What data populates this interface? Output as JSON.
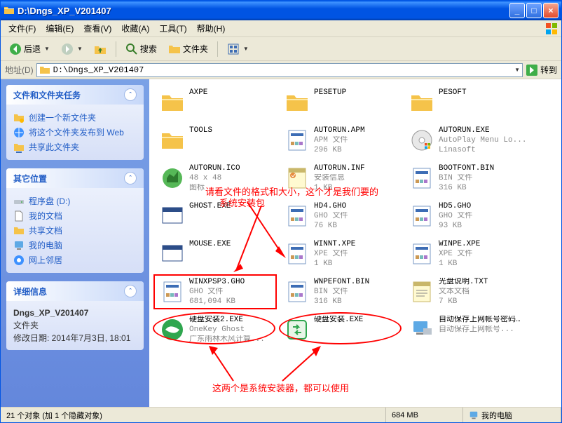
{
  "title": "D:\\Dngs_XP_V201407",
  "menu": [
    "文件(F)",
    "编辑(E)",
    "查看(V)",
    "收藏(A)",
    "工具(T)",
    "帮助(H)"
  ],
  "toolbar": {
    "back": "后退",
    "search": "搜索",
    "folders": "文件夹"
  },
  "address": {
    "label": "地址(D)",
    "value": "D:\\Dngs_XP_V201407",
    "go": "转到"
  },
  "sidebar": {
    "tasks": {
      "title": "文件和文件夹任务",
      "items": [
        "创建一个新文件夹",
        "将这个文件夹发布到 Web",
        "共享此文件夹"
      ]
    },
    "places": {
      "title": "其它位置",
      "items": [
        "程序盘 (D:)",
        "我的文档",
        "共享文档",
        "我的电脑",
        "网上邻居"
      ]
    },
    "details": {
      "title": "详细信息",
      "name": "Dngs_XP_V201407",
      "type": "文件夹",
      "modified": "修改日期: 2014年7月3日, 18:01"
    }
  },
  "files": [
    {
      "name": "AXPE",
      "meta1": "",
      "meta2": "",
      "icon": "folder"
    },
    {
      "name": "PESETUP",
      "meta1": "",
      "meta2": "",
      "icon": "folder"
    },
    {
      "name": "PESOFT",
      "meta1": "",
      "meta2": "",
      "icon": "folder"
    },
    {
      "name": "TOOLS",
      "meta1": "",
      "meta2": "",
      "icon": "folder"
    },
    {
      "name": "AUTORUN.APM",
      "meta1": "APM 文件",
      "meta2": "296 KB",
      "icon": "doc"
    },
    {
      "name": "AUTORUN.EXE",
      "meta1": "AutoPlay Menu Lo...",
      "meta2": "Linasoft",
      "icon": "disc"
    },
    {
      "name": "AUTORUN.ICO",
      "meta1": "48 x 48",
      "meta2": "图标",
      "icon": "ico"
    },
    {
      "name": "AUTORUN.INF",
      "meta1": "安装信息",
      "meta2": "1 KB",
      "icon": "inf"
    },
    {
      "name": "BOOTFONT.BIN",
      "meta1": "BIN 文件",
      "meta2": "316 KB",
      "icon": "doc"
    },
    {
      "name": "GHOST.EXE",
      "meta1": "",
      "meta2": "",
      "icon": "app"
    },
    {
      "name": "HD4.GHO",
      "meta1": "GHO 文件",
      "meta2": "76 KB",
      "icon": "doc"
    },
    {
      "name": "HD5.GHO",
      "meta1": "GHO 文件",
      "meta2": "93 KB",
      "icon": "doc"
    },
    {
      "name": "MOUSE.EXE",
      "meta1": "",
      "meta2": "",
      "icon": "app"
    },
    {
      "name": "WINNT.XPE",
      "meta1": "XPE 文件",
      "meta2": "1 KB",
      "icon": "doc"
    },
    {
      "name": "WINPE.XPE",
      "meta1": "XPE 文件",
      "meta2": "1 KB",
      "icon": "doc"
    },
    {
      "name": "WINXPSP3.GHO",
      "meta1": "GHO 文件",
      "meta2": "681,094 KB",
      "icon": "doc"
    },
    {
      "name": "WNPEFONT.BIN",
      "meta1": "BIN 文件",
      "meta2": "316 KB",
      "icon": "doc"
    },
    {
      "name": "光盘说明.TXT",
      "meta1": "文本文档",
      "meta2": "7 KB",
      "icon": "txt"
    },
    {
      "name": "硬盘安装2.EXE",
      "meta1": "OneKey Ghost",
      "meta2": "广东雨林木风计算...",
      "icon": "green"
    },
    {
      "name": "硬盘安装.EXE",
      "meta1": "",
      "meta2": "",
      "icon": "green2"
    },
    {
      "name": "自动保存上网帐号密码到D盘.EXE",
      "meta1": "自动保存上网帐号...",
      "meta2": "",
      "icon": "pc"
    }
  ],
  "annotations": {
    "line1": "请看文件的格式和大小，这个才是我们要的",
    "line2": "系统安装包",
    "line3": "这两个是系统安装器，都可以使用"
  },
  "status": {
    "objects": "21 个对象 (加 1 个隐藏对象)",
    "size": "684 MB",
    "location": "我的电脑"
  }
}
